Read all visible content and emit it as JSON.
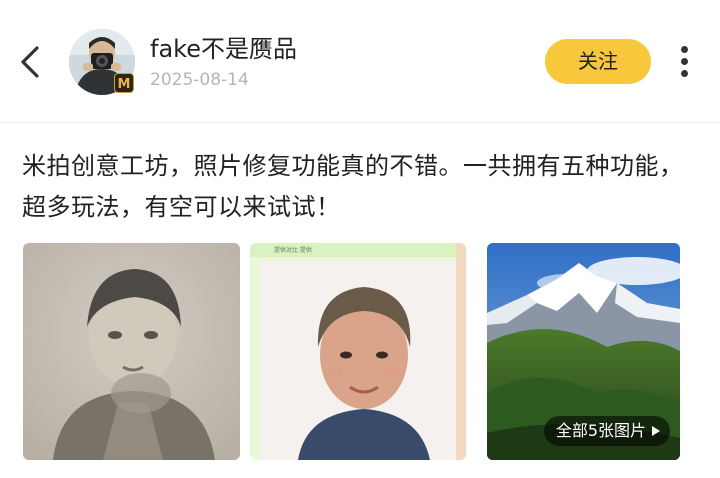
{
  "header": {
    "back_icon": "chevron-left-icon",
    "username": "fake不是赝品",
    "date": "2025-08-14",
    "badge_letter": "M",
    "follow_label": "关注",
    "more_icon": "vertical-dots-icon"
  },
  "post": {
    "text": "米拍创意工坊，照片修复功能真的不错。一共拥有五种功能，超多玩法，有空可以来试试！"
  },
  "gallery": {
    "photo_2_caption": "提供对比 提供",
    "more_badge": "全部5张图片"
  },
  "colors": {
    "accent": "#f8c83c",
    "muted": "#b6b6b6",
    "text": "#222222"
  }
}
